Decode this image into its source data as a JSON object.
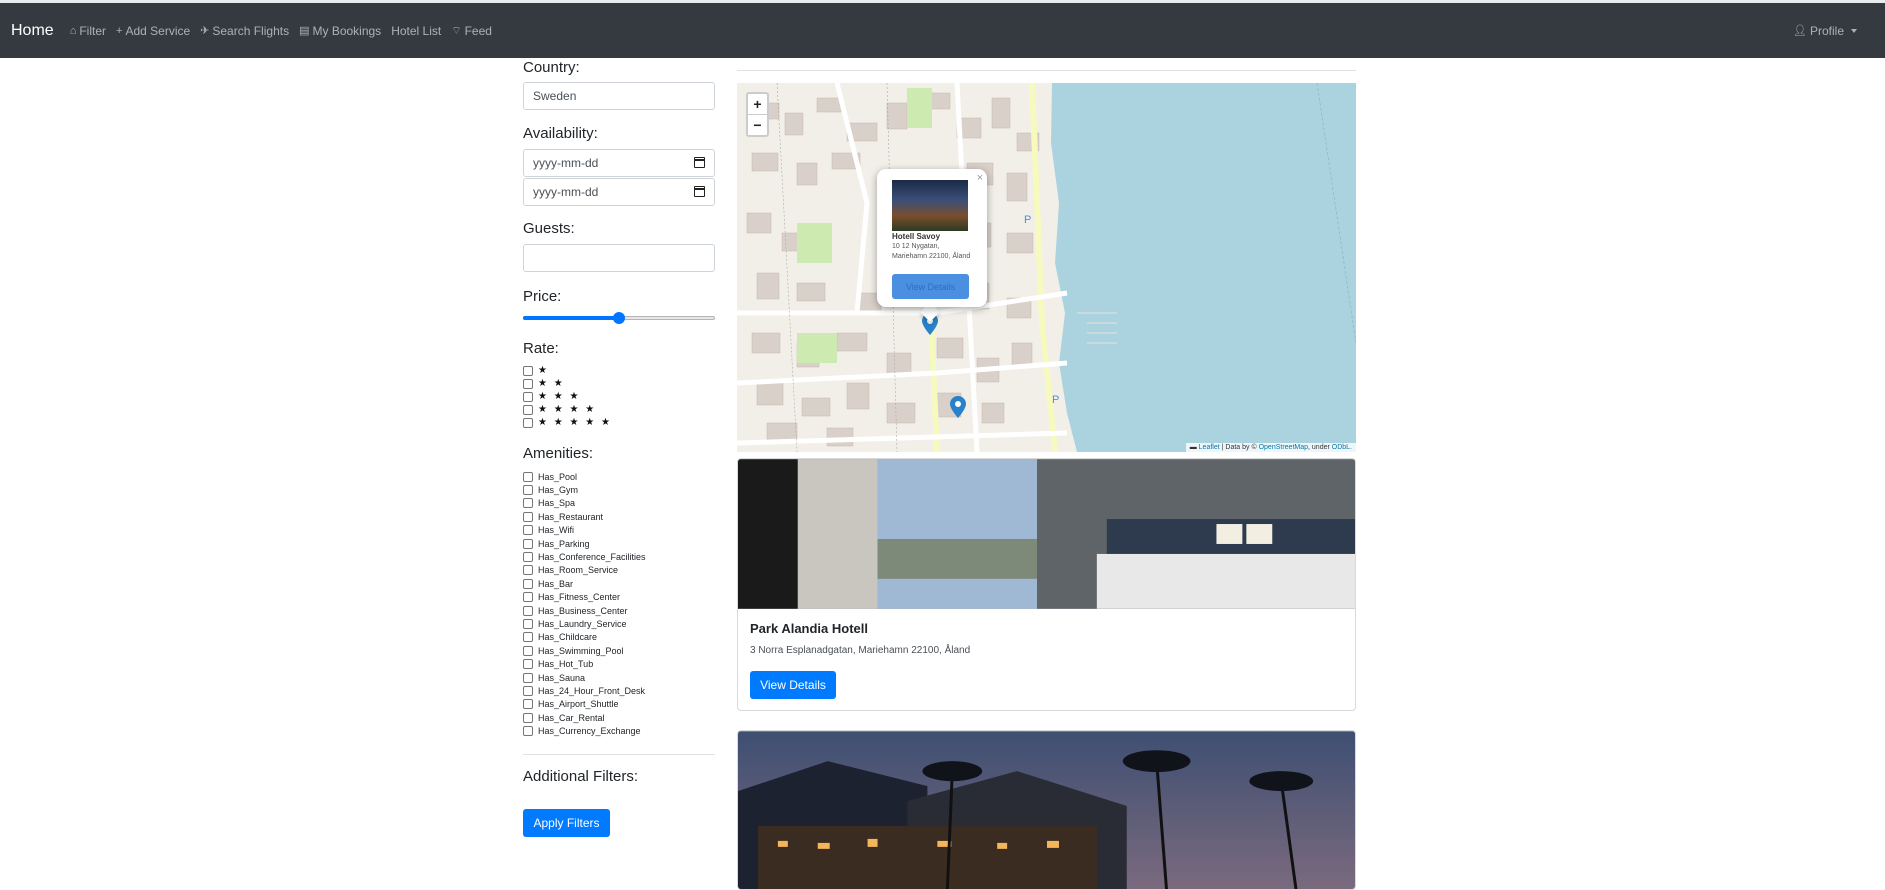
{
  "navbar": {
    "brand": "Home",
    "items": [
      {
        "label": "Filter",
        "icon": "home-icon"
      },
      {
        "label": "Add Service",
        "icon": "plus-icon"
      },
      {
        "label": "Search Flights",
        "icon": "plane-icon"
      },
      {
        "label": "My Bookings",
        "icon": "book-icon"
      },
      {
        "label": "Hotel List",
        "icon": ""
      },
      {
        "label": "Feed",
        "icon": "rss-icon"
      }
    ],
    "profile": "Profile"
  },
  "filters": {
    "country_label": "Country:",
    "country_value": "Sweden",
    "availability_label": "Availability:",
    "date_placeholder_1": "yyyy-mm-dd",
    "date_placeholder_2": "yyyy-mm-dd",
    "guests_label": "Guests:",
    "guests_value": "",
    "price_label": "Price:",
    "price_slider_fraction": 0.5,
    "rate_label": "Rate:",
    "rate_stars": [
      "★",
      "★ ★",
      "★ ★ ★",
      "★ ★ ★ ★",
      "★ ★ ★ ★ ★"
    ],
    "amenities_label": "Amenities:",
    "amenities": [
      "Has_Pool",
      "Has_Gym",
      "Has_Spa",
      "Has_Restaurant",
      "Has_Wifi",
      "Has_Parking",
      "Has_Conference_Facilities",
      "Has_Room_Service",
      "Has_Bar",
      "Has_Fitness_Center",
      "Has_Business_Center",
      "Has_Laundry_Service",
      "Has_Childcare",
      "Has_Swimming_Pool",
      "Has_Hot_Tub",
      "Has_Sauna",
      "Has_24_Hour_Front_Desk",
      "Has_Airport_Shuttle",
      "Has_Car_Rental",
      "Has_Currency_Exchange"
    ],
    "additional_label": "Additional Filters:",
    "apply_button": "Apply Filters"
  },
  "map": {
    "zoom_in": "+",
    "zoom_out": "−",
    "popup": {
      "close": "×",
      "title": "Hotell Savoy",
      "address": "10 12 Nygatan, Mariehamn 22100, Åland",
      "button": "View Details"
    },
    "attribution_leaflet": "Leaflet",
    "attribution_text": "| Data by ©",
    "attribution_osm": "OpenStreetMap",
    "attribution_under": ", under",
    "attribution_odbl": "ODbL."
  },
  "hotels": [
    {
      "name": "Park Alandia Hotell",
      "address": "3 Norra Esplanadgatan, Mariehamn 22100, Åland",
      "button": "View Details"
    }
  ],
  "colors": {
    "navbar": "#343a40",
    "primary": "#007bff",
    "water": "#aad3df",
    "land": "#f2efe9"
  }
}
